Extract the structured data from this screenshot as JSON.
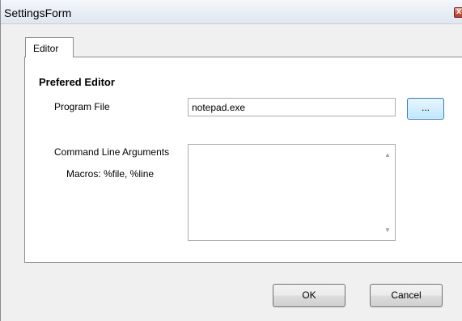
{
  "window": {
    "title": "SettingsForm",
    "close_glyph": "x"
  },
  "tabs": [
    {
      "label": "Editor"
    }
  ],
  "editor": {
    "group_title": "Prefered Editor",
    "program_file_label": "Program File",
    "program_file_value": "notepad.exe",
    "browse_label": "...",
    "command_line_label": "Command Line Arguments",
    "macros_label": "Macros:  %file, %line",
    "command_line_value": ""
  },
  "buttons": {
    "ok": "OK",
    "cancel": "Cancel"
  },
  "icons": {
    "close": "close-icon",
    "scroll_up": "scroll-up-arrow-icon",
    "scroll_down": "scroll-down-arrow-icon"
  }
}
